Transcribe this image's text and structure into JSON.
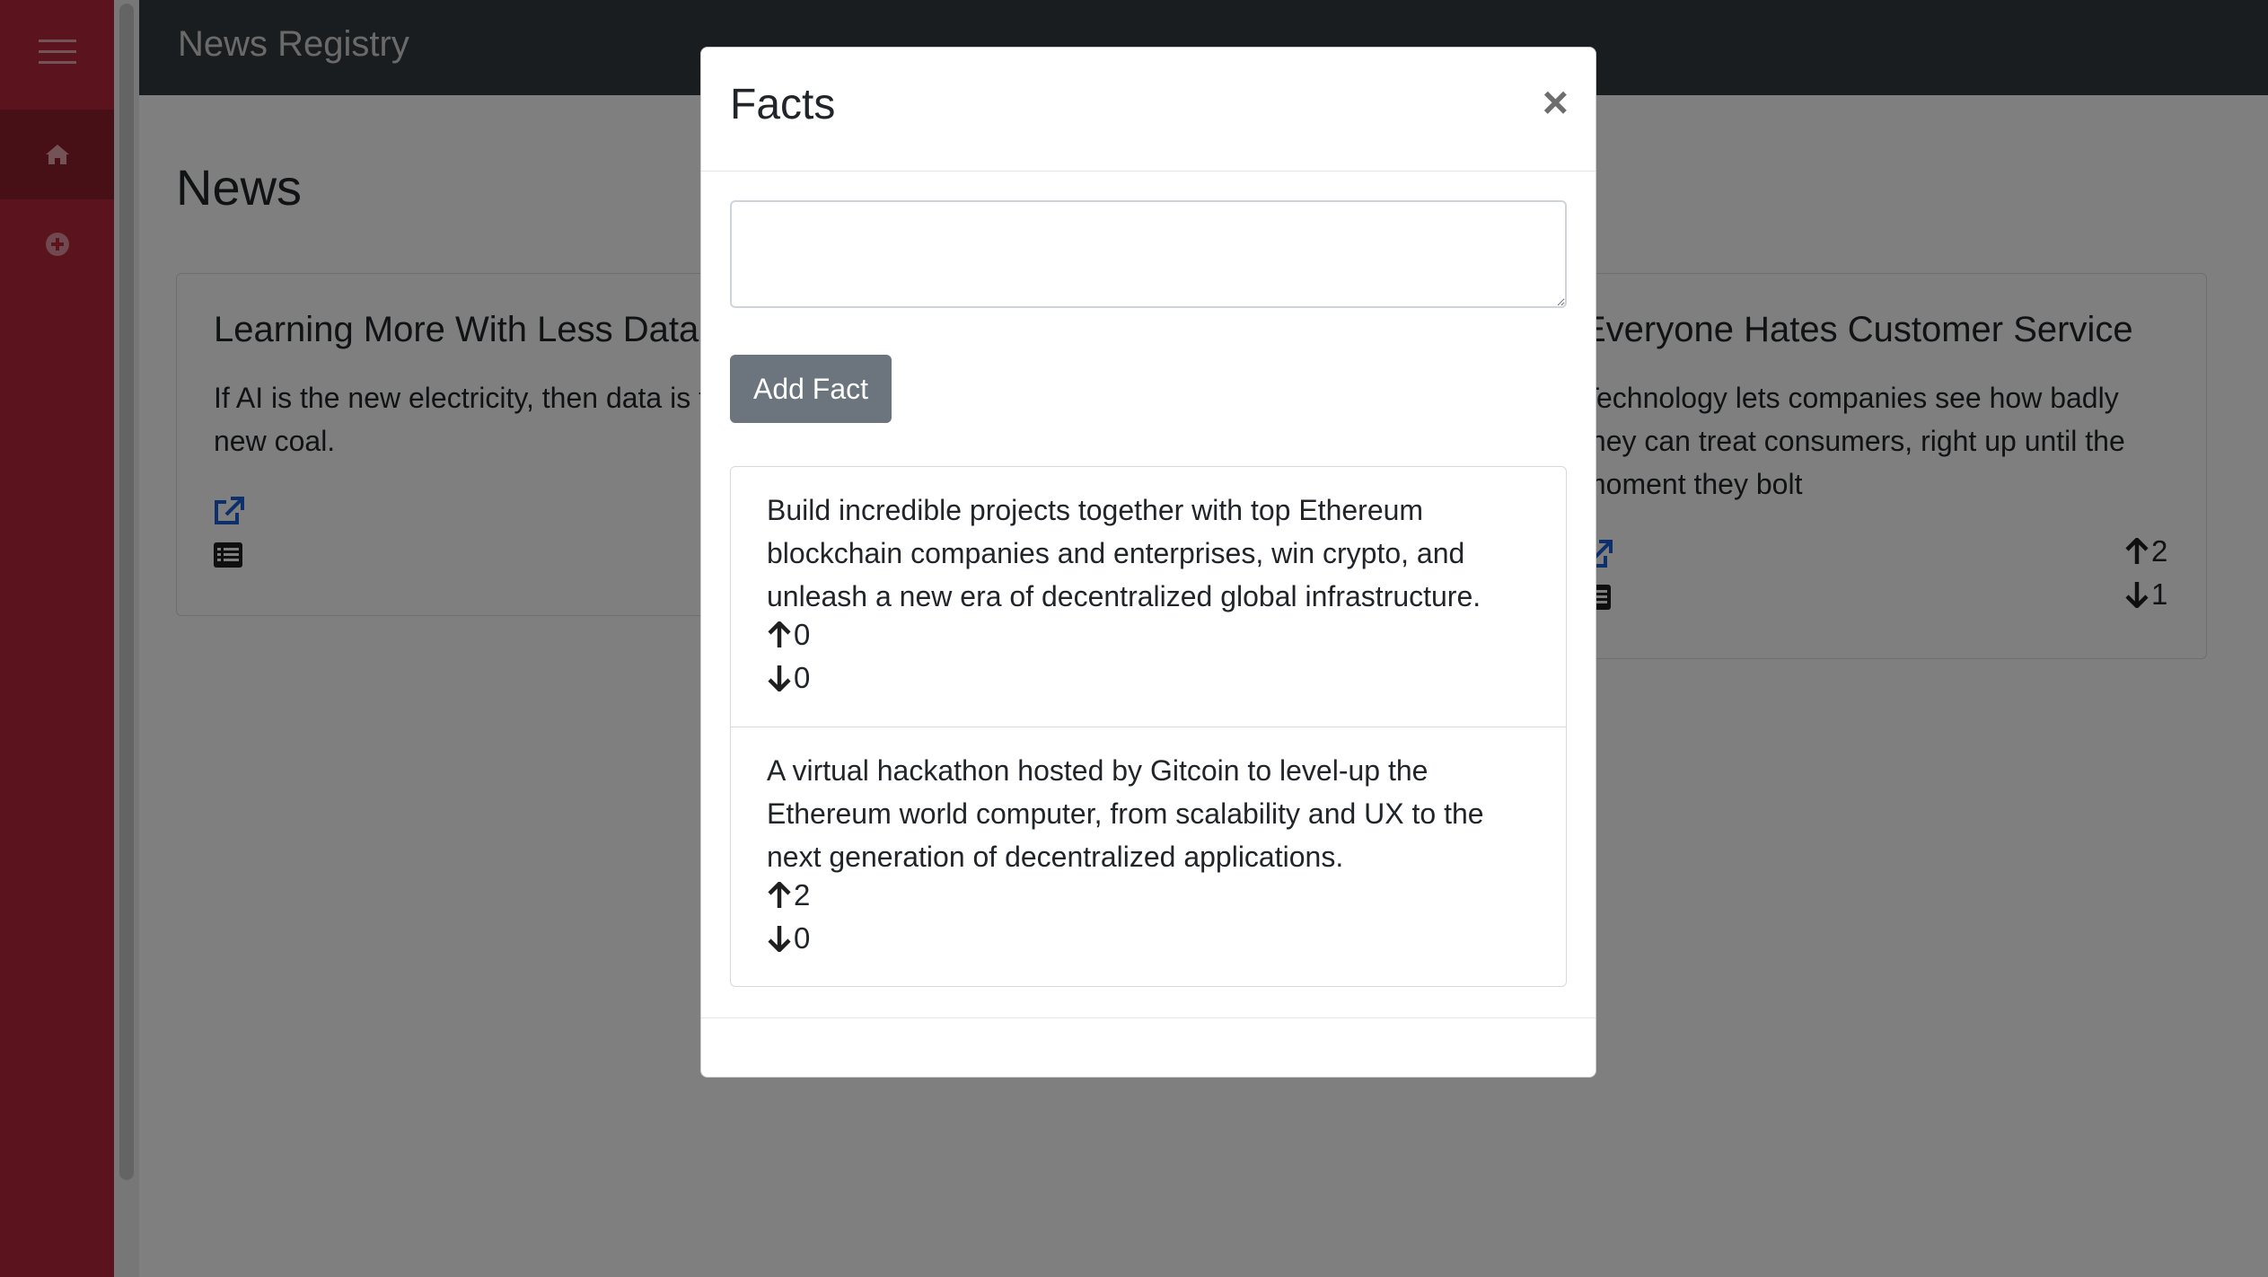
{
  "app": {
    "brand": "News Registry"
  },
  "page": {
    "title": "News"
  },
  "cards": [
    {
      "title": "Learning More With Less Data",
      "text": "If AI is the new electricity, then data is the new coal."
    },
    {
      "title": "Everyone Hates Customer Service",
      "text": "Technology lets companies see how badly they can treat consumers, right up until the moment they bolt",
      "upvotes": "2",
      "downvotes": "1"
    }
  ],
  "modal": {
    "title": "Facts",
    "close_label": "×",
    "textarea_value": "",
    "add_button_label": "Add Fact",
    "facts": [
      {
        "text": "Build incredible projects together with top Ethereum blockchain companies and enterprises, win crypto, and unleash a new era of decentralized global infrastructure.",
        "upvotes": "0",
        "downvotes": "0"
      },
      {
        "text": "A virtual hackathon hosted by Gitcoin to level-up the Ethereum world computer, from scalability and UX to the next generation of decentralized applications.",
        "upvotes": "2",
        "downvotes": "0"
      }
    ]
  },
  "colors": {
    "sidebar": "#b7293a",
    "sidebar_active": "#8f1f2c",
    "topbar": "#343a40",
    "link": "#1a5fd6",
    "button": "#6c757d"
  },
  "icons": {
    "menu": "hamburger-icon",
    "home": "home-icon",
    "add": "plus-circle-icon",
    "external": "external-link-icon",
    "list": "list-icon",
    "up": "arrow-up-icon",
    "down": "arrow-down-icon",
    "close": "close-icon"
  }
}
